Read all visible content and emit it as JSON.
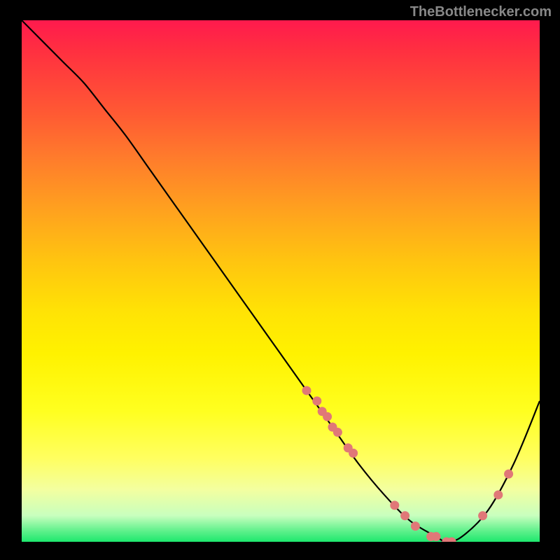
{
  "attribution": "TheBottlenecker.com",
  "chart_data": {
    "type": "line",
    "title": "",
    "xlabel": "",
    "ylabel": "",
    "xlim": [
      0,
      100
    ],
    "ylim": [
      0,
      100
    ],
    "series": [
      {
        "name": "bottleneck-curve",
        "x": [
          0,
          4,
          8,
          12,
          16,
          20,
          25,
          30,
          35,
          40,
          45,
          50,
          55,
          60,
          65,
          70,
          75,
          80,
          82,
          85,
          90,
          95,
          100
        ],
        "y": [
          100,
          96,
          92,
          88,
          83,
          78,
          71,
          64,
          57,
          50,
          43,
          36,
          29,
          22,
          15,
          9,
          4,
          1,
          0,
          1,
          6,
          15,
          27
        ]
      }
    ],
    "markers": {
      "name": "highlight-points",
      "color": "#e07878",
      "x": [
        55,
        57,
        58,
        59,
        60,
        61,
        63,
        64,
        72,
        74,
        76,
        79,
        80,
        82,
        83,
        89,
        92,
        94
      ],
      "y": [
        29,
        27,
        25,
        24,
        22,
        21,
        18,
        17,
        7,
        5,
        3,
        1,
        1,
        0,
        0,
        5,
        9,
        13
      ]
    }
  }
}
